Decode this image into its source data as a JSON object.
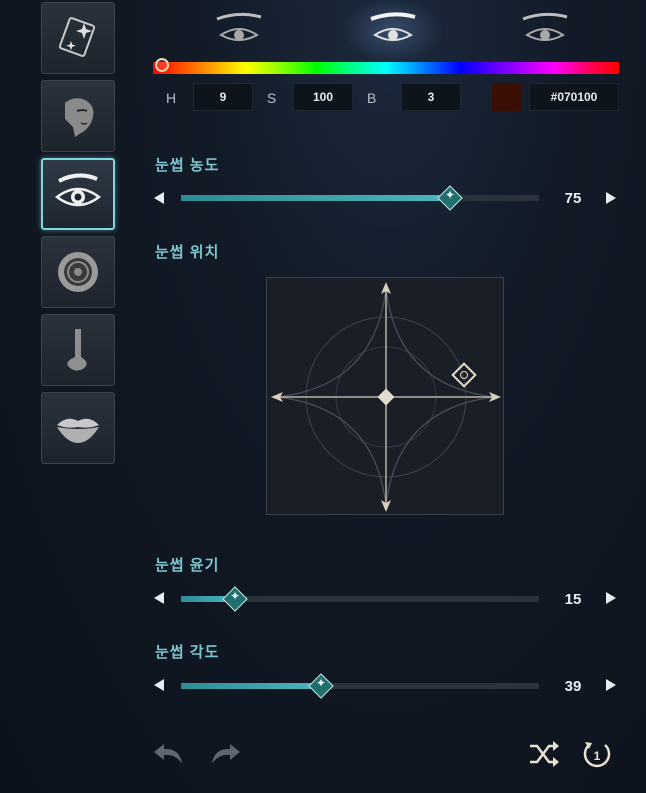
{
  "sidebar": {
    "items": [
      {
        "name": "sparkle-presets",
        "active": false
      },
      {
        "name": "face-shape",
        "active": false
      },
      {
        "name": "eyebrow",
        "active": true
      },
      {
        "name": "eye-iris",
        "active": false
      },
      {
        "name": "nose",
        "active": false
      },
      {
        "name": "lips",
        "active": false
      }
    ]
  },
  "eyebrow_presets": {
    "count": 3,
    "selected_index": 1
  },
  "color": {
    "h_label": "H",
    "h_value": "9",
    "s_label": "S",
    "s_value": "100",
    "b_label": "B",
    "b_value": "3",
    "hex": "#070100",
    "swatch_color": "#3b0f05"
  },
  "sliders": {
    "density": {
      "label": "눈썹 농도",
      "value": "75",
      "fraction": 0.75
    },
    "shine": {
      "label": "눈썹 윤기",
      "value": "15",
      "fraction": 0.15
    },
    "angle": {
      "label": "눈썹 각도",
      "value": "39",
      "fraction": 0.39
    }
  },
  "position": {
    "label": "눈썹 위치"
  },
  "accent_color": "#4bb7c0"
}
